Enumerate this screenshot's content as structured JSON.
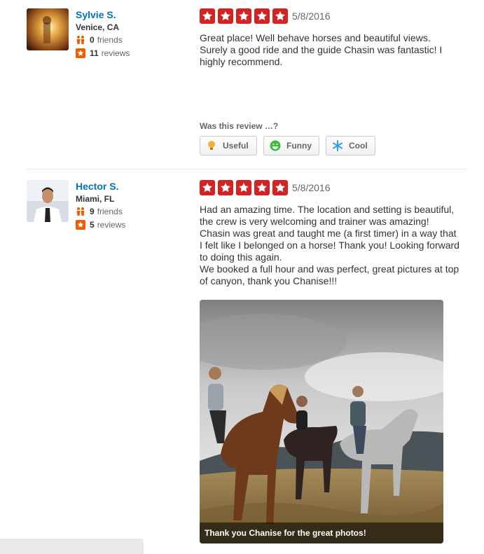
{
  "reviews": [
    {
      "user": {
        "name": "Sylvie S.",
        "location": "Venice, CA",
        "friends": "0",
        "friends_label": "friends",
        "reviews": "11",
        "reviews_label": "reviews"
      },
      "rating": 5,
      "date": "5/8/2016",
      "text": [
        "Great place! Well behave horses and beautiful views. Surely a good ride and the guide Chasin was fantastic! I highly recommend."
      ],
      "vote_prompt": "Was this review …?",
      "votes": {
        "useful": "Useful",
        "funny": "Funny",
        "cool": "Cool"
      }
    },
    {
      "user": {
        "name": "Hector S.",
        "location": "Miami, FL",
        "friends": "9",
        "friends_label": "friends",
        "reviews": "5",
        "reviews_label": "reviews"
      },
      "rating": 5,
      "date": "5/8/2016",
      "text": [
        "Had an amazing time. The location and setting is beautiful, the crew is very welcoming and trainer was amazing! Chasin was great and taught me (a first timer) in a way that I felt like I belonged on a horse! Thank you! Looking forward to doing this again.",
        "We booked a full hour and was perfect, great pictures at top of canyon, thank you Chanise!!!"
      ],
      "photo_caption": "Thank you Chanise for the great photos!"
    }
  ],
  "colors": {
    "link": "#0073bb",
    "star": "#d32323",
    "friends_icon": "#f15c00",
    "reviews_icon": "#f15c00"
  }
}
